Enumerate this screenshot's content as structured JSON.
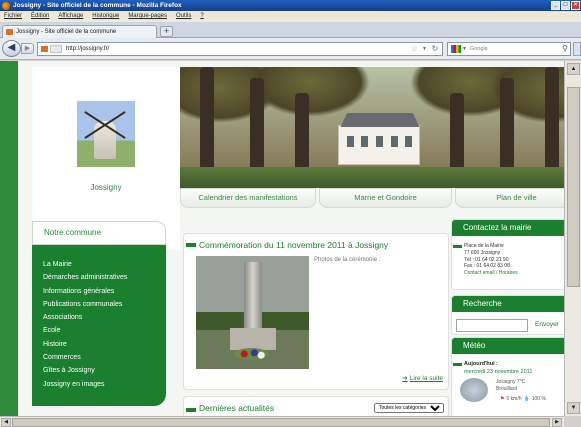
{
  "window": {
    "title": "Jossigny - Site officiel de la commune - Mozilla Firefox",
    "buttons": [
      "_",
      "□",
      "×"
    ]
  },
  "menu": [
    "Fichier",
    "Édition",
    "Affichage",
    "Historique",
    "Marque-pages",
    "Outils",
    "?"
  ],
  "tabs": [
    {
      "label": "Jossigny - Site officiel de la commune"
    }
  ],
  "newtab_label": "+",
  "address": {
    "url": "http://jossigny.fr/",
    "search_placeholder": "Google"
  },
  "site": {
    "logo_text": "Jossigny",
    "nav": [
      "Calendrier des manifestations",
      "Marne et Gondoire",
      "Plan de ville"
    ],
    "left_menu": {
      "title": "Notre commune",
      "items": [
        "La Mairie",
        "Démarches administratives",
        "Informations générales",
        "Publications communales",
        "Associations",
        "Ecole",
        "Histoire",
        "Commerces",
        "Gîtes à Jossigny",
        "Jossigny en images"
      ]
    },
    "article": {
      "title": "Commémoration du 11 novembre 2011 à Jossigny",
      "photos_note": "Photos de la cérémonie :",
      "read_more": "Lire la suite"
    },
    "news": {
      "title": "Dernières actualités",
      "filter": "Toutes les catégories"
    },
    "contact": {
      "title": "Contactez la mairie",
      "lines": [
        "Place de la Mairie",
        "77 600 Jossigny",
        "Tél : 01 64 02 21 90",
        "Fax : 01 64 02 83 08"
      ],
      "link": "Contact email / Horaires"
    },
    "search": {
      "title": "Recherche",
      "button": "Envoyer"
    },
    "meteo": {
      "title": "Météo",
      "day_label": "Aujourd'hui :",
      "date": "mercredi 23 novembre 2011",
      "place_temp": "Jossigny 7°C",
      "condition": "Brouillard",
      "wind": "0 km/h",
      "humidity": "100 %"
    }
  }
}
